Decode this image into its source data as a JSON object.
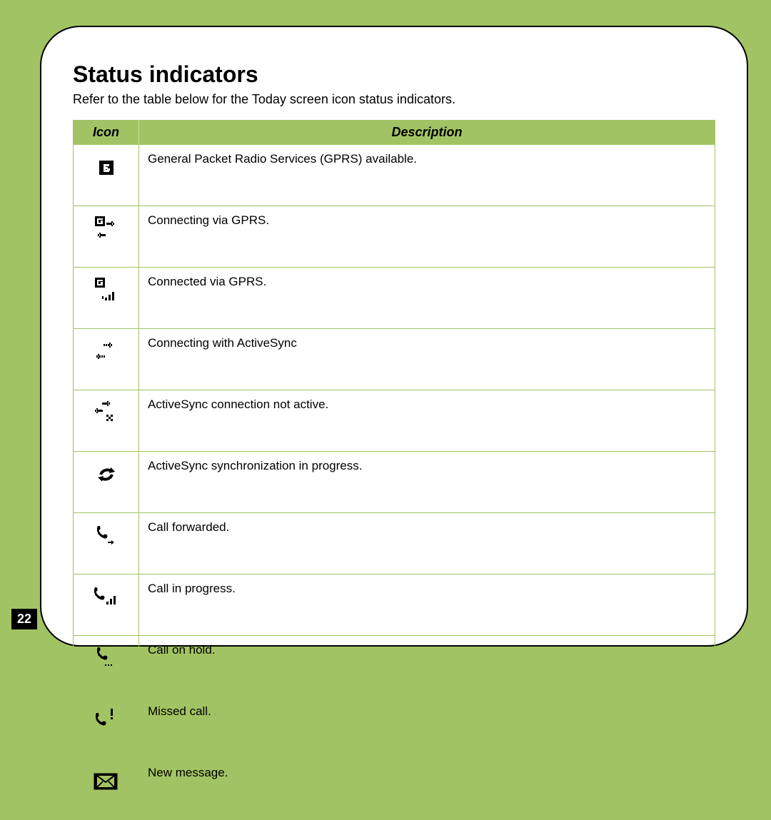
{
  "page_number": "22",
  "title": "Status indicators",
  "subtitle": "Refer to the table below for the Today screen icon status indicators.",
  "table": {
    "columns": [
      "Icon",
      "Description"
    ],
    "rows": [
      {
        "icon": "gprs-available-icon",
        "description": "General Packet Radio Services (GPRS) available."
      },
      {
        "icon": "gprs-connecting-icon",
        "description": "Connecting via GPRS."
      },
      {
        "icon": "gprs-connected-icon",
        "description": "Connected via GPRS."
      },
      {
        "icon": "activesync-connecting-icon",
        "description": "Connecting with ActiveSync"
      },
      {
        "icon": "activesync-inactive-icon",
        "description": "ActiveSync connection not active."
      },
      {
        "icon": "activesync-syncing-icon",
        "description": "ActiveSync synchronization in progress."
      },
      {
        "icon": "call-forwarded-icon",
        "description": "Call forwarded."
      },
      {
        "icon": "call-in-progress-icon",
        "description": "Call in progress."
      },
      {
        "icon": "call-on-hold-icon",
        "description": "Call on hold."
      },
      {
        "icon": "missed-call-icon",
        "description": "Missed call."
      },
      {
        "icon": "new-message-icon",
        "description": "New message."
      }
    ]
  }
}
